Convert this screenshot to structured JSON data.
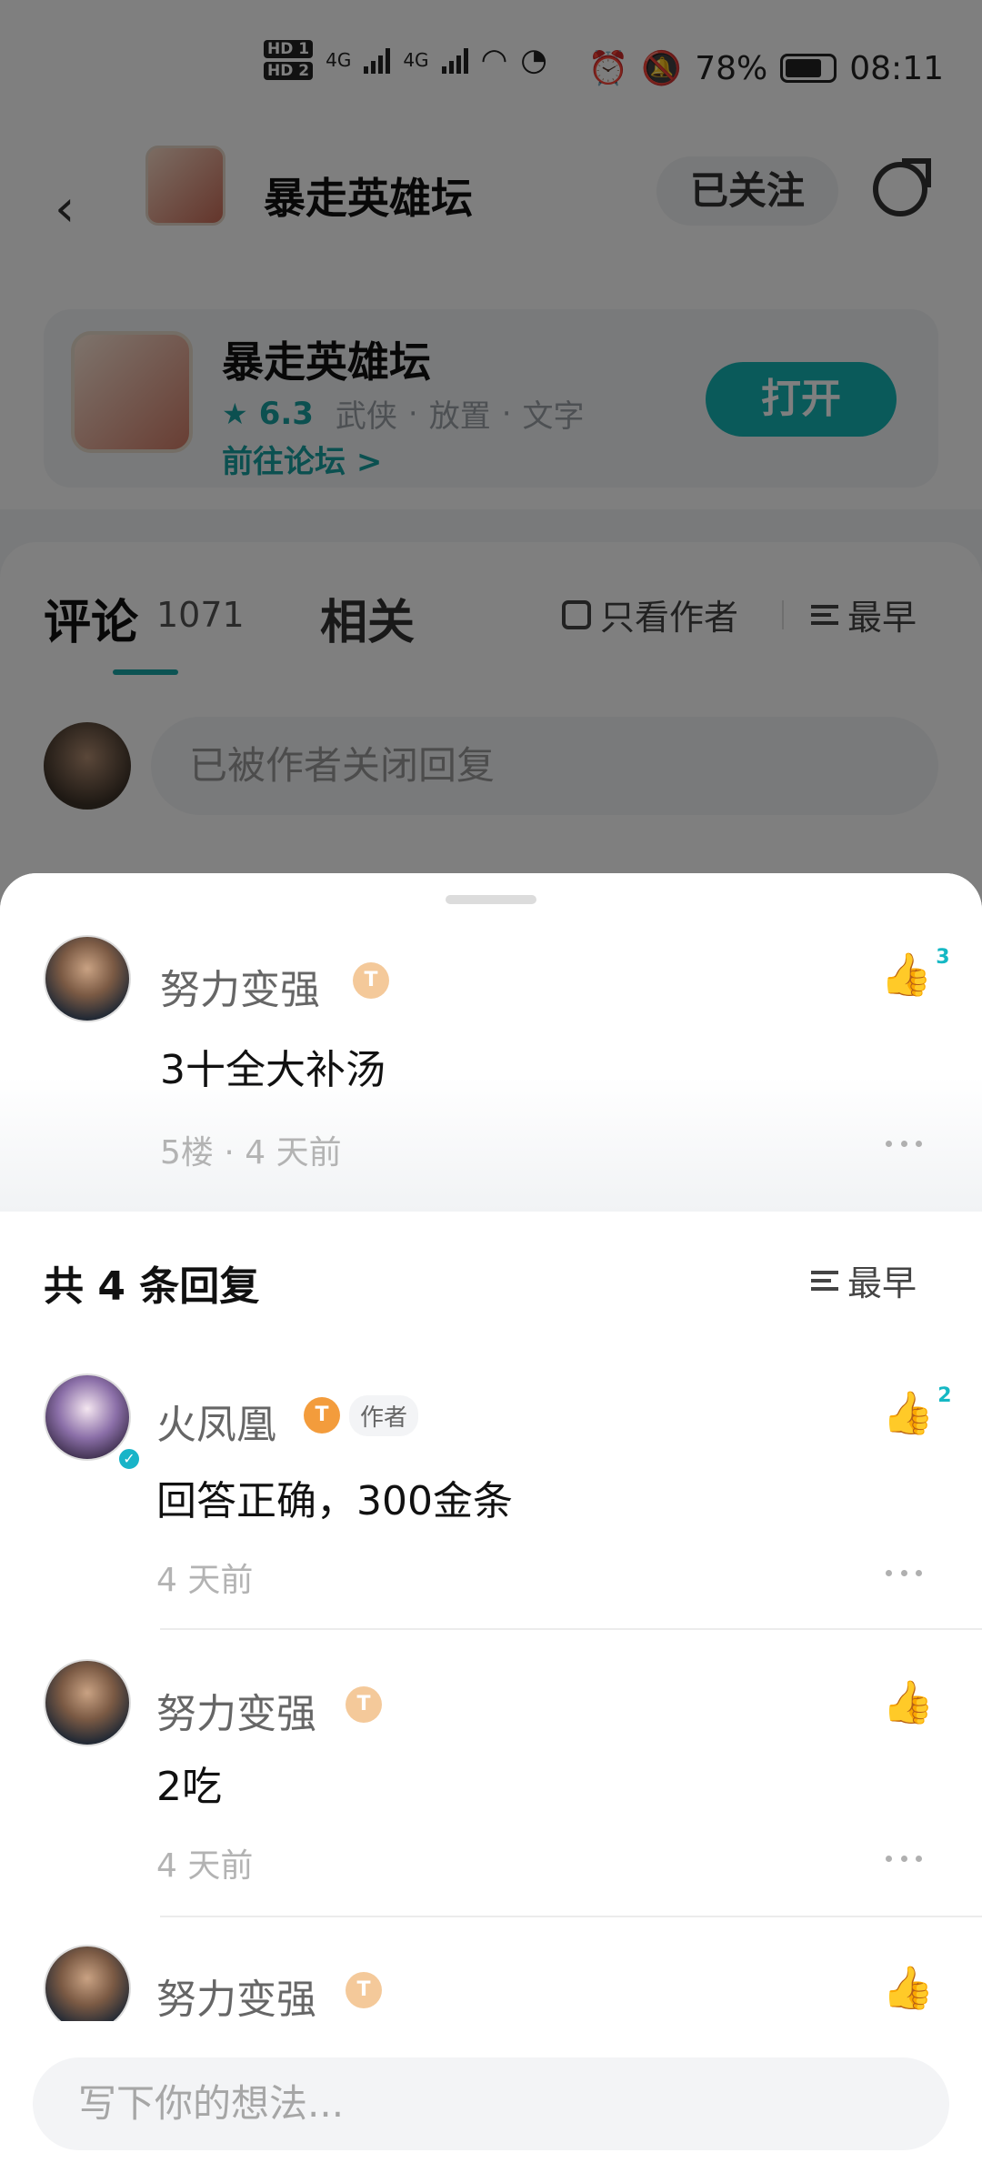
{
  "status_bar": {
    "hd1": "HD 1",
    "hd2": "HD 2",
    "net1": "4G",
    "net2": "4G",
    "battery": "78%",
    "time": "08:11"
  },
  "header": {
    "title": "暴走英雄坛",
    "follow_label": "已关注"
  },
  "game_card": {
    "name": "暴走英雄坛",
    "rating": "6.3",
    "tags": [
      "武侠",
      "放置",
      "文字"
    ],
    "link_label": "前往论坛 >",
    "open_label": "打开"
  },
  "tabs": {
    "comment_label": "评论",
    "comment_count": "1071",
    "related_label": "相关",
    "only_author_label": "只看作者",
    "sort_label": "最早",
    "reply_placeholder": "已被作者关闭回复"
  },
  "sheet": {
    "main_comment": {
      "username": "努力变强",
      "level": "T",
      "content": "3十全大补汤",
      "meta": "5楼 · 4 天前",
      "likes": "3"
    },
    "replies_title": "共 4 条回复",
    "sort_label": "最早",
    "replies": [
      {
        "username": "火凤凰",
        "level": "T",
        "author_tag": "作者",
        "content": "回答正确，300金条",
        "meta": "4 天前",
        "likes": "2"
      },
      {
        "username": "努力变强",
        "level": "T",
        "content": "2吃",
        "meta": "4 天前"
      },
      {
        "username": "努力变强",
        "level": "T"
      }
    ],
    "input_placeholder": "写下你的想法..."
  },
  "colors": {
    "accent": "#15b4b4",
    "like_active": "#15b8c4"
  }
}
